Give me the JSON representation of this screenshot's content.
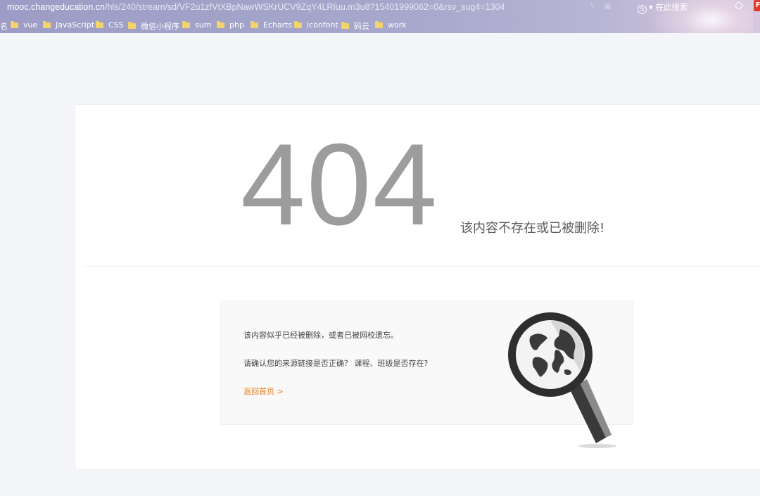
{
  "browser": {
    "url_domain": "mooc.changeducation.cn",
    "url_path": "/hls/240/stream/sd/VF2u1zfVtXBpNawWSKrUCV9ZqY4LRIuu.m3u8?15401999062=0&rsv_sug4=1304",
    "search_placeholder": "在此搜索",
    "search_engine_logo": "S",
    "extension_badge": "F",
    "bookmark_edge_text": "名",
    "bookmarks": [
      "vue",
      "JavaScript",
      "CSS",
      "微信小程序",
      "sum",
      "php",
      "Echarts",
      "iconfont",
      "码云",
      "work"
    ]
  },
  "error_page": {
    "code": "404",
    "message": "该内容不存在或已被删除!",
    "hint_line1": "该内容似乎已经被删除，或者已被网校遗忘。",
    "hint_line2": "请确认您的来源链接是否正确？ 课程、班级是否存在?",
    "back_link": "返回首页 >"
  },
  "colors": {
    "accent_link": "#ea7a1a",
    "code_gray": "#9c9c9c"
  }
}
